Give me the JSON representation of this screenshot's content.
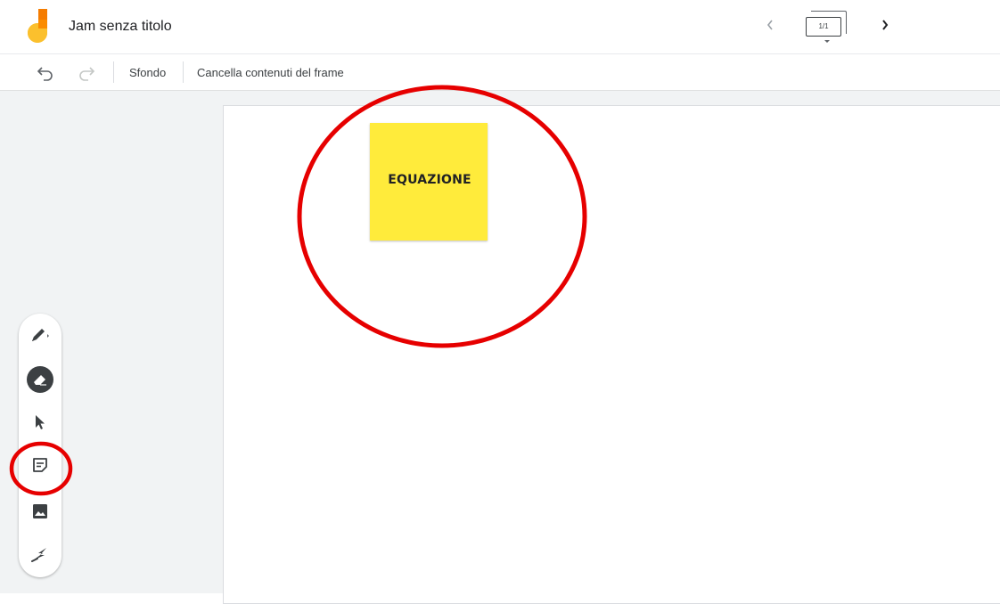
{
  "app": {
    "doc_title": "Jam senza titolo",
    "frame_counter": "1/1"
  },
  "toolbar": {
    "sfondo_label": "Sfondo",
    "clear_frame_label": "Cancella contenuti del frame"
  },
  "canvas": {
    "sticky_note_text": "EQUAZIONE",
    "sticky_note_color": "#ffeb3b"
  },
  "tools": [
    {
      "name": "pen-tool",
      "icon": "pen-icon"
    },
    {
      "name": "eraser-tool",
      "icon": "eraser-icon"
    },
    {
      "name": "select-tool",
      "icon": "cursor-arrow-icon"
    },
    {
      "name": "sticky-note-tool",
      "icon": "sticky-note-icon"
    },
    {
      "name": "image-tool",
      "icon": "image-icon"
    },
    {
      "name": "laser-tool",
      "icon": "laser-icon"
    }
  ],
  "colors": {
    "accent_annotation": "#e60000",
    "workspace_bg": "#f1f3f4",
    "logo_orange": "#f57c00",
    "logo_yellow": "#fbc02d"
  }
}
